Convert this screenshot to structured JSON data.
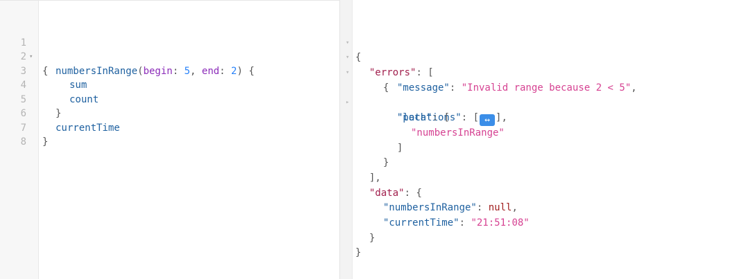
{
  "query_editor": {
    "lines": [
      {
        "num": "1",
        "indent": "",
        "tokens": {
          "open": "{"
        }
      },
      {
        "num": "2",
        "field": "numbersInRange",
        "open_paren": "(",
        "arg1": "begin",
        "colon1": ": ",
        "val1": "5",
        "comma": ", ",
        "arg2": "end",
        "colon2": ": ",
        "val2": "2",
        "close_paren": ")",
        "brace": " {"
      },
      {
        "num": "3",
        "field": "sum"
      },
      {
        "num": "4",
        "field": "count"
      },
      {
        "num": "5",
        "brace": "}"
      },
      {
        "num": "6",
        "field": "currentTime"
      },
      {
        "num": "7",
        "brace": "}"
      },
      {
        "num": "8"
      }
    ]
  },
  "result_viewer": {
    "l1_brace": "{",
    "errors_key": "\"errors\"",
    "colon": ": ",
    "open_bracket": "[",
    "l3_brace": "{",
    "message_key": "\"message\"",
    "message_value": "\"Invalid range because 2 < 5\"",
    "comma": ",",
    "locations_key": "\"locations\"",
    "locations_open": "[",
    "expand_glyph": "↔",
    "locations_close": "],",
    "path_key": "\"path\"",
    "path_open": "[",
    "path_item": "\"numbersInRange\"",
    "path_close": "]",
    "l10_brace": "}",
    "errors_close": "],",
    "data_key": "\"data\"",
    "data_open": "{",
    "numbersInRange_key": "\"numbersInRange\"",
    "numbersInRange_value": "null",
    "currentTime_key": "\"currentTime\"",
    "currentTime_value": "\"21:51:08\"",
    "data_close": "}",
    "root_close": "}"
  },
  "icons": {
    "fold_open": "▾",
    "fold_closed": "▸"
  }
}
